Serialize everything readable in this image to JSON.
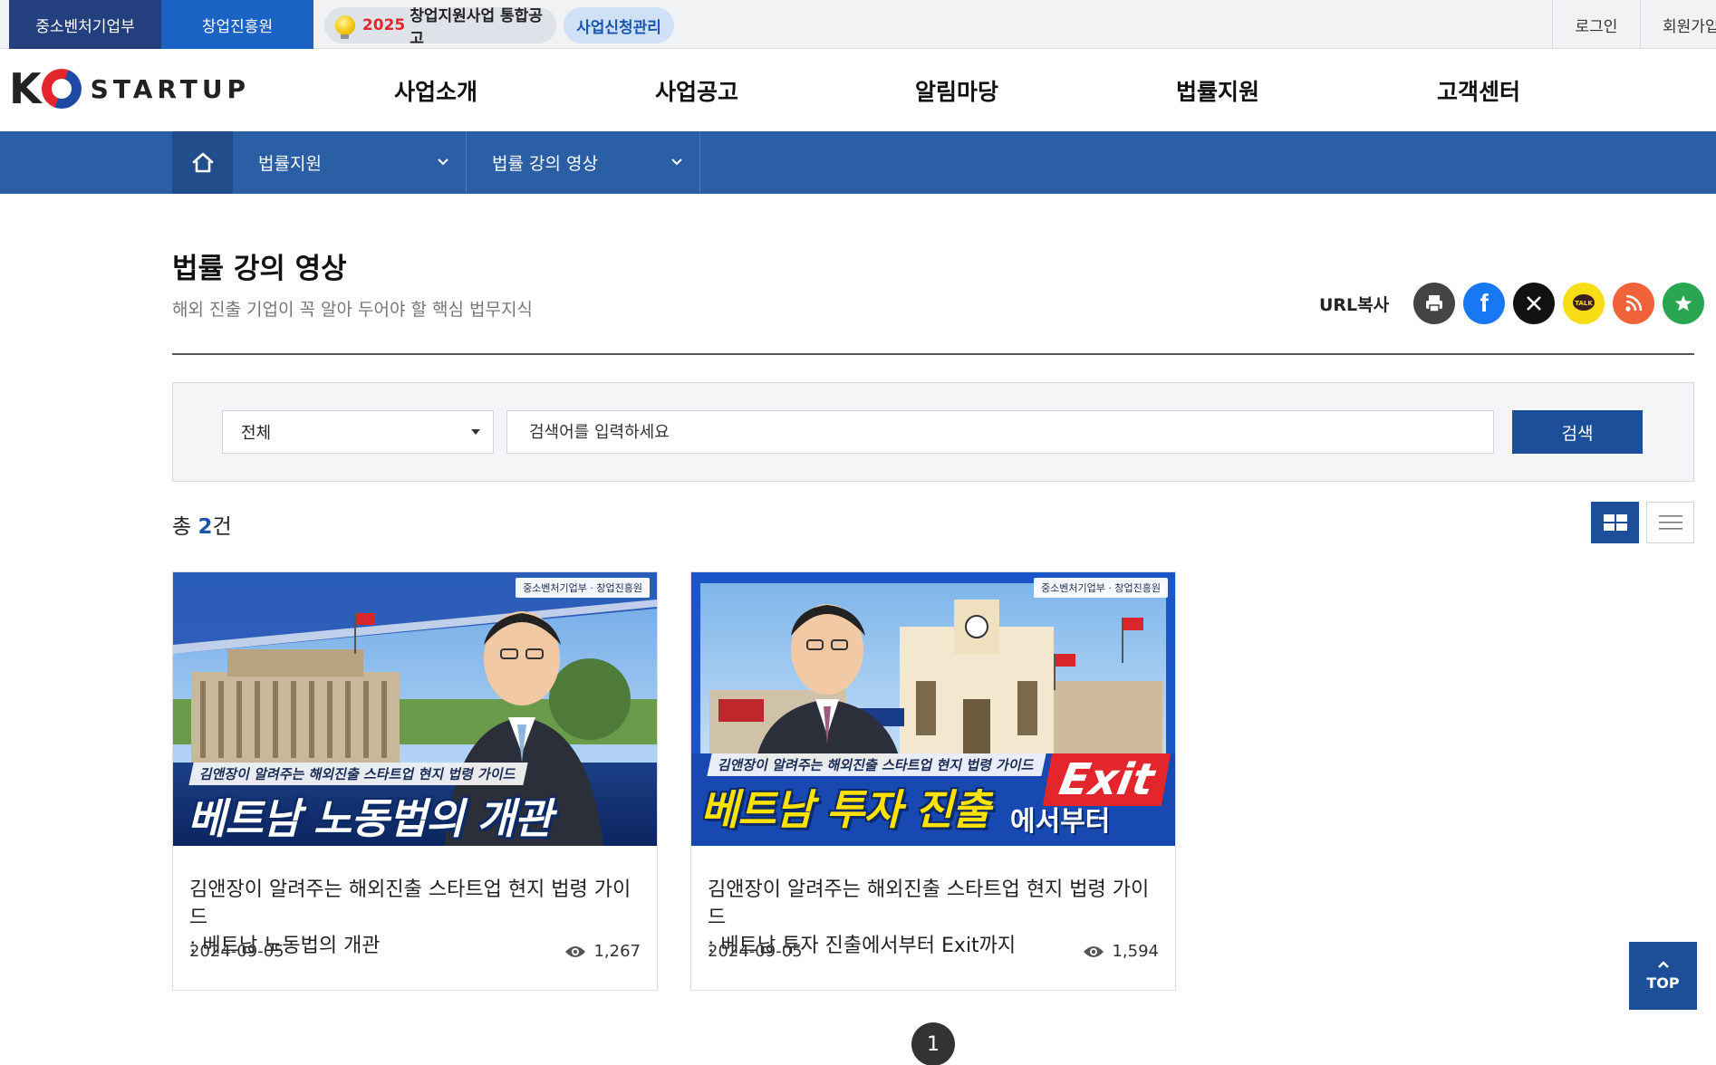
{
  "utility": {
    "ministry": "중소벤처기업부",
    "agency": "창업진흥원",
    "notice_year": "2025",
    "notice_text": "창업지원사업 통합공고",
    "apply_manage": "사업신청관리",
    "login": "로그인",
    "join": "회원가입"
  },
  "header": {
    "logo_k": "K",
    "logo_word": "STARTUP",
    "gnb": [
      "사업소개",
      "사업공고",
      "알림마당",
      "법률지원",
      "고객센터"
    ]
  },
  "subnav": {
    "home_icon": "home-icon",
    "depth1": "법률지원",
    "depth2": "법률 강의 영상"
  },
  "page": {
    "title": "법률 강의 영상",
    "description": "해외 진출 기업이 꼭 알아 두어야 할 핵심 법무지식",
    "url_copy": "URL복사",
    "share_icons": [
      {
        "name": "print-icon",
        "color": "#444444"
      },
      {
        "name": "facebook-icon",
        "color": "#1877f2"
      },
      {
        "name": "x-icon",
        "color": "#111111"
      },
      {
        "name": "kakaotalk-icon",
        "color": "#f7dc16"
      },
      {
        "name": "rss-icon",
        "color": "#f0623a"
      },
      {
        "name": "star-icon",
        "color": "#2aa551"
      }
    ]
  },
  "search": {
    "type_selected": "전체",
    "placeholder": "검색어를 입력하세요",
    "button": "검색"
  },
  "list": {
    "total_prefix": "총",
    "total_count": "2",
    "total_suffix": "건",
    "cards": [
      {
        "title_line1": "김앤장이 알려주는 해외진출 스타트업 현지 법령 가이드",
        "title_line2": ": 베트남 노동법의 개관",
        "date": "2024-09-05",
        "views": "1,267",
        "thumb_small": "김앤장이 알려주는 해외진출 스타트업 현지 법령 가이드",
        "thumb_big": "베트남 노동법의 개관",
        "thumb_badge": "중소벤처기업부 · 창업진흥원"
      },
      {
        "title_line1": "김앤장이 알려주는 해외진출 스타트업 현지 법령 가이드",
        "title_line2": ": 베트남 투자 진출에서부터 Exit까지",
        "date": "2024-09-05",
        "views": "1,594",
        "thumb_small": "김앤장이 알려주는 해외진출 스타트업 현지 법령 가이드",
        "thumb_big": "베트남 투자 진출",
        "thumb_after": "에서부터",
        "thumb_exit": "Exit",
        "thumb_badge": "중소벤처기업부 · 창업진흥원"
      }
    ]
  },
  "pagination": {
    "current": "1"
  },
  "top_button": {
    "label": "TOP"
  },
  "colors": {
    "primary": "#1d4f98",
    "subnav": "#2a5fa5",
    "ministry": "#233f7e",
    "agency": "#1a63c5"
  }
}
